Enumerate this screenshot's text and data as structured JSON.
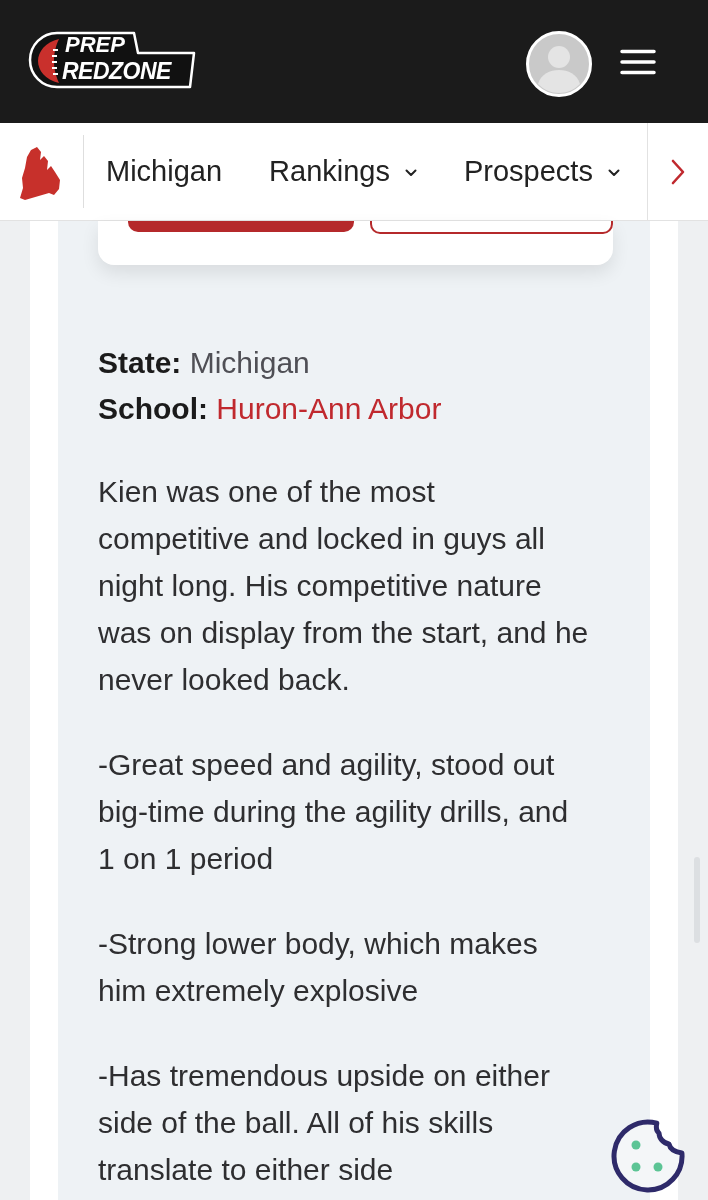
{
  "header": {
    "logo": {
      "line_1": "PREP",
      "line_2": "REDZONE"
    }
  },
  "nav": {
    "items": [
      {
        "label": "Michigan",
        "dropdown": false
      },
      {
        "label": "Rankings",
        "dropdown": true
      },
      {
        "label": "Prospects",
        "dropdown": true
      }
    ]
  },
  "card": {
    "buttons": [
      {
        "kind": "filled"
      },
      {
        "kind": "outlined"
      }
    ]
  },
  "details": [
    {
      "label": "State:",
      "value": "Michigan",
      "kind": "text"
    },
    {
      "label": "School:",
      "value": "Huron-Ann Arbor",
      "kind": "link"
    }
  ],
  "paragraphs": [
    "Kien was one of the most competitive and locked in guys all night long. His competitive nature was on display from the start, and he never looked back.",
    "-Great speed and agility, stood out big-time during the agility drills, and 1 on 1 period",
    "-Strong lower body, which makes him extremely explosive",
    "-Has tremendous upside on either side of the ball. All of his skills translate to either side"
  ]
}
